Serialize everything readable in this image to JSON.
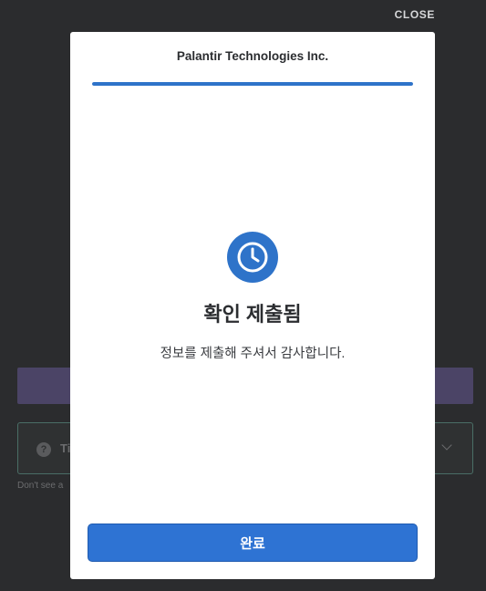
{
  "overlay": {
    "close_label": "CLOSE"
  },
  "background": {
    "select_text": "Ti",
    "hint_text": "Don't see a",
    "help_icon": "question-circle-icon",
    "chevron_icon": "chevron-down-icon"
  },
  "modal": {
    "company_name": "Palantir Technologies Inc.",
    "progress": 1.0,
    "status_icon": "clock-icon",
    "heading": "확인 제출됨",
    "message": "정보를 제출해 주셔서 감사합니다.",
    "done_label": "완료"
  },
  "colors": {
    "accent": "#2e73c9",
    "button": "#2e73d3",
    "backdrop": "#2b2c2e"
  }
}
